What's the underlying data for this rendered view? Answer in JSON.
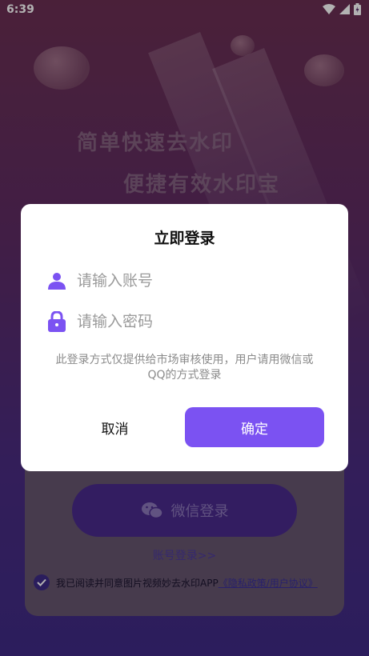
{
  "status_bar": {
    "time": "6:39"
  },
  "background": {
    "slogan_1": "简单快速去水印",
    "slogan_2": "便捷有效水印宝"
  },
  "login_page": {
    "wechat_login_label": "微信登录",
    "account_login_link": "账号登录>>",
    "agreement_text": "我已阅读并同意图片视频妙去水印APP",
    "policy_link": "《隐私政策/用户协议》",
    "agreement_checked": true
  },
  "dialog": {
    "title": "立即登录",
    "account_placeholder": "请输入账号",
    "password_placeholder": "请输入密码",
    "note": "此登录方式仅提供给市场审核使用，用户请用微信或QQ的方式登录",
    "cancel_label": "取消",
    "confirm_label": "确定"
  },
  "colors": {
    "accent": "#7b52f2",
    "icon": "#7b52f2"
  }
}
